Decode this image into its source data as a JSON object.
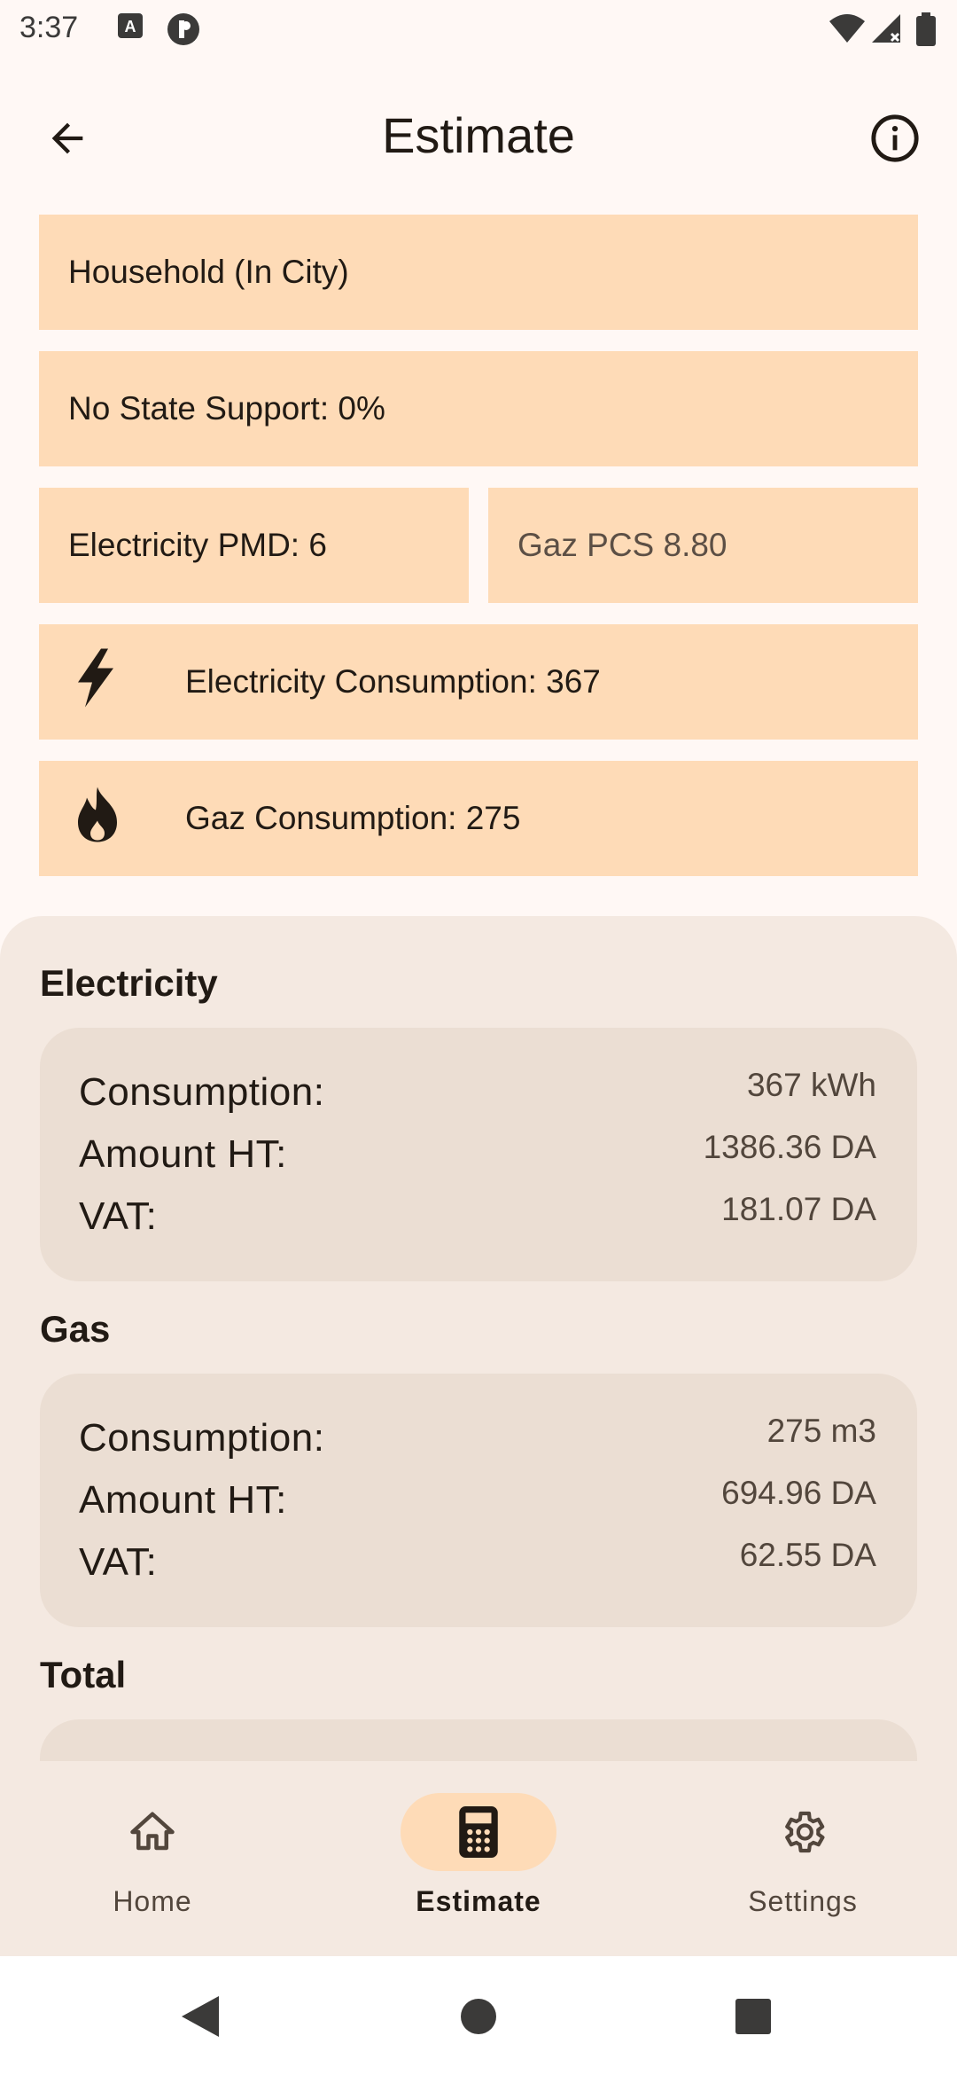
{
  "status_bar": {
    "time": "3:37",
    "left_icons": [
      "autofill-a-icon",
      "circle-p-icon"
    ],
    "right_icons": [
      "wifi-icon",
      "cellular-signal-icon",
      "battery-icon"
    ]
  },
  "app_bar": {
    "title": "Estimate",
    "back_icon": "arrow-back-icon",
    "info_icon": "info-icon"
  },
  "inputs": {
    "category": "Household (In City)",
    "state_support": "No State Support: 0%",
    "electricity_pmd": "Electricity PMD: 6",
    "gaz_pcs_placeholder": "Gaz PCS 8.80",
    "electricity_consumption": "Electricity Consumption: 367",
    "gaz_consumption": "Gaz Consumption: 275"
  },
  "results": {
    "electricity": {
      "title": "Electricity",
      "consumption_label": "Consumption:",
      "consumption_value": "367 kWh",
      "amount_label": "Amount HT:",
      "amount_value": "1386.36 DA",
      "vat_label": "VAT:",
      "vat_value": "181.07 DA"
    },
    "gas": {
      "title": "Gas",
      "consumption_label": "Consumption:",
      "consumption_value": "275 m3",
      "amount_label": "Amount HT:",
      "amount_value": "694.96 DA",
      "vat_label": "VAT:",
      "vat_value": "62.55 DA"
    },
    "total": {
      "title": "Total"
    }
  },
  "bottom_nav": {
    "items": [
      {
        "label": "Home",
        "icon": "home-icon",
        "active": false
      },
      {
        "label": "Estimate",
        "icon": "calculator-icon",
        "active": true
      },
      {
        "label": "Settings",
        "icon": "gear-icon",
        "active": false
      }
    ]
  },
  "colors": {
    "background": "#FFF8F5",
    "field": "#FEDBB7",
    "sheet": "#F4E9E1",
    "card": "#EBDED3",
    "text": "#211A14"
  }
}
